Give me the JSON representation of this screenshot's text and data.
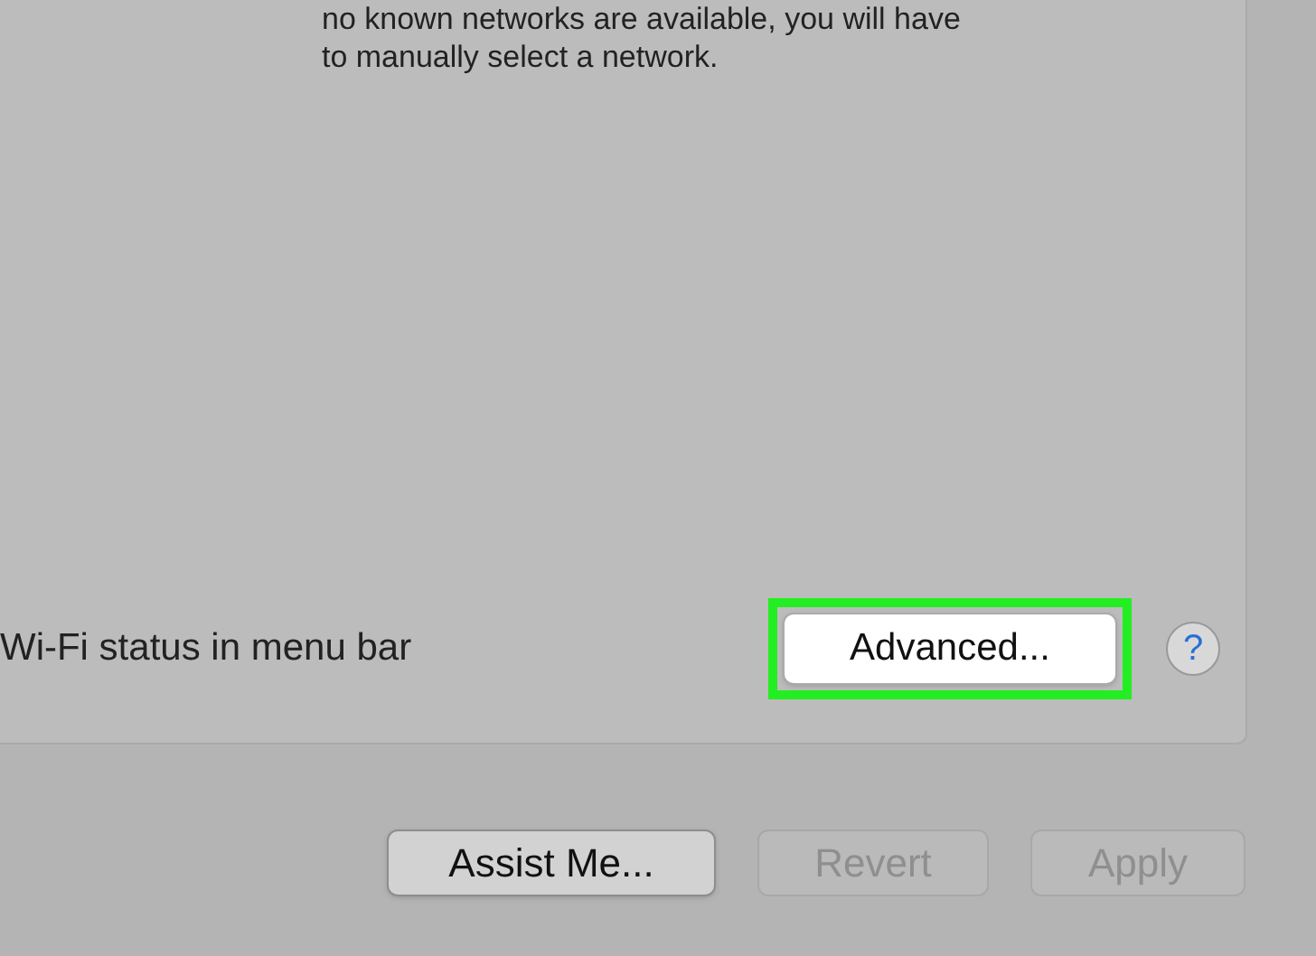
{
  "description_lines": [
    "no known networks are available, you will have",
    "to manually select a network."
  ],
  "status_option": {
    "label": "Wi-Fi status in menu bar"
  },
  "advanced_button": {
    "label": "Advanced...",
    "highlighted": true
  },
  "help_button": {
    "label": "?"
  },
  "buttons": [
    {
      "label": "Assist Me...",
      "disabled": false
    },
    {
      "label": "Revert",
      "disabled": true
    },
    {
      "label": "Apply",
      "disabled": true
    }
  ]
}
